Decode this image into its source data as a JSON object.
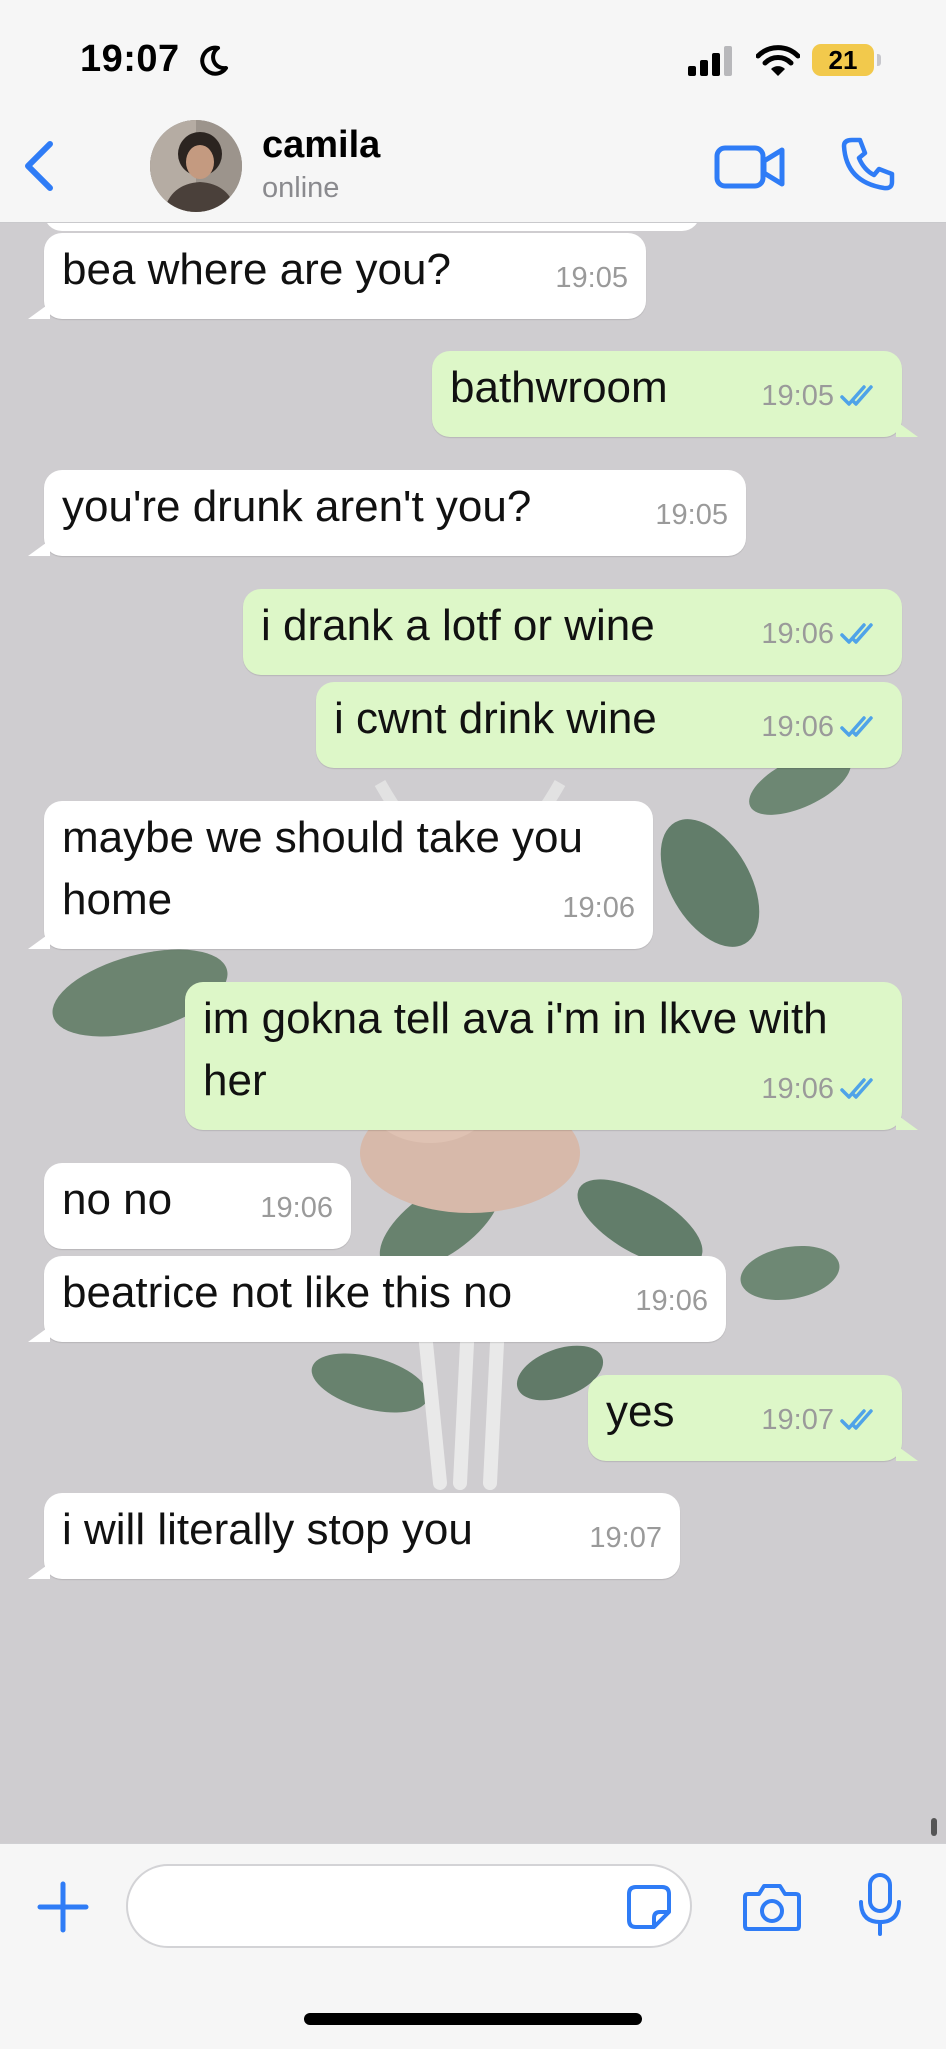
{
  "status_bar": {
    "time": "19:07",
    "battery": "21"
  },
  "header": {
    "contact_name": "camila",
    "contact_status": "online"
  },
  "messages": [
    {
      "dir": "in",
      "text": "bea where are you?",
      "time": "19:05"
    },
    {
      "dir": "out",
      "text": "bathwroom",
      "time": "19:05",
      "read": true
    },
    {
      "dir": "in",
      "text": "you're drunk aren't you?",
      "time": "19:05"
    },
    {
      "dir": "out",
      "text": "i drank a lotf or wine",
      "time": "19:06",
      "read": true
    },
    {
      "dir": "out",
      "text": "i cwnt drink wine",
      "time": "19:06",
      "read": true
    },
    {
      "dir": "in",
      "text": "maybe we should take you\nhome",
      "time": "19:06"
    },
    {
      "dir": "out",
      "text": "im gokna tell ava i'm in lkve with\nher",
      "time": "19:06",
      "read": true
    },
    {
      "dir": "in",
      "text": "no no",
      "time": "19:06"
    },
    {
      "dir": "in",
      "text": "beatrice not like this no",
      "time": "19:06"
    },
    {
      "dir": "out",
      "text": "yes",
      "time": "19:07",
      "read": true
    },
    {
      "dir": "in",
      "text": "i will literally stop you",
      "time": "19:07"
    }
  ],
  "composer": {
    "placeholder": ""
  },
  "colors": {
    "accent": "#2f7cf6",
    "outgoing_bubble": "#ddf7c8",
    "incoming_bubble": "#ffffff",
    "read_ticks": "#4fa3e8"
  }
}
